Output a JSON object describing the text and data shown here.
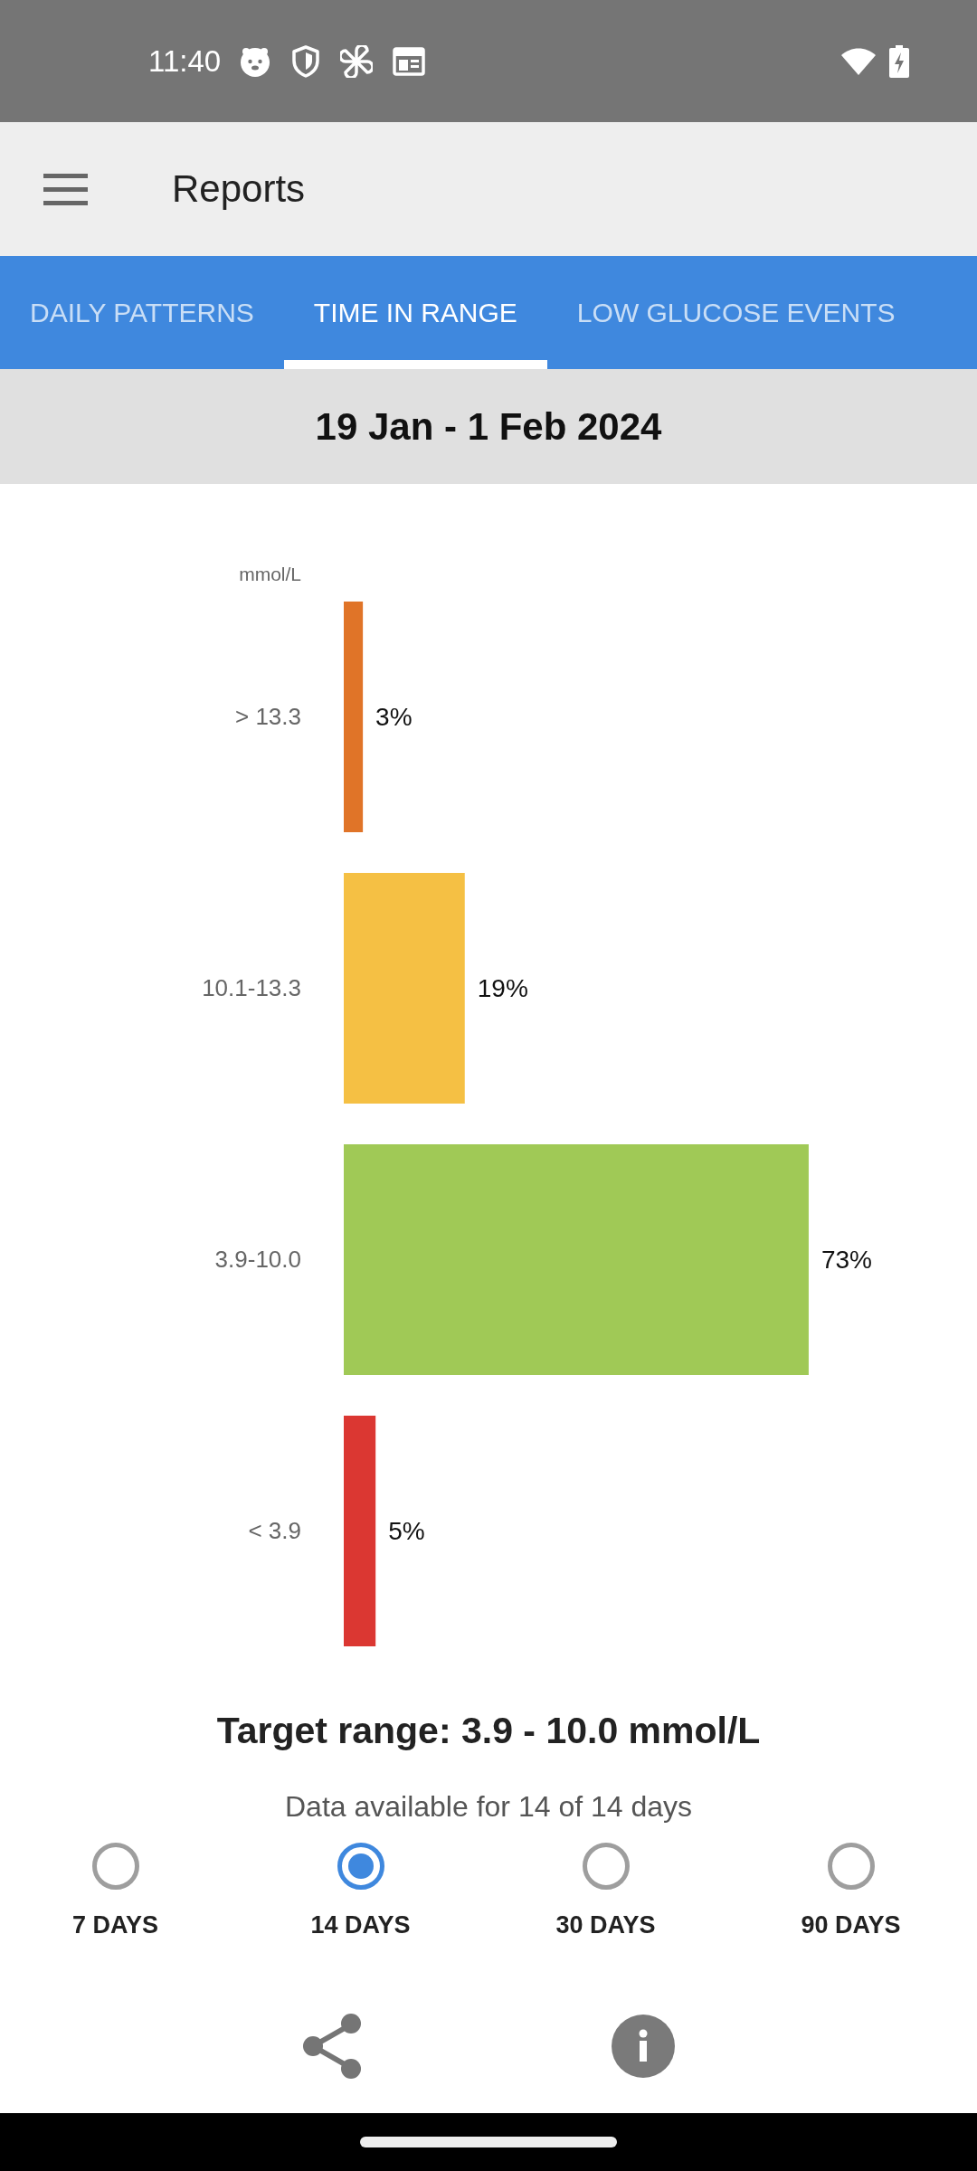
{
  "status_bar": {
    "time": "11:40"
  },
  "app_bar": {
    "title": "Reports"
  },
  "tabs": [
    {
      "label": "DAILY PATTERNS",
      "selected": false
    },
    {
      "label": "TIME IN RANGE",
      "selected": true
    },
    {
      "label": "LOW GLUCOSE EVENTS",
      "selected": false
    }
  ],
  "date_range": "19 Jan - 1 Feb 2024",
  "chart": {
    "chart_data": {
      "type": "bar",
      "orientation": "horizontal",
      "ylabel": "mmol/L",
      "categories": [
        "> 13.3",
        "10.1-13.3",
        "3.9-10.0",
        "< 3.9"
      ],
      "values": [
        3,
        19,
        73,
        5
      ],
      "value_labels": [
        "3%",
        "19%",
        "73%",
        "5%"
      ],
      "colors": [
        "#e07428",
        "#f5c044",
        "#a0c956",
        "#db3732"
      ]
    }
  },
  "target_range": "Target range: 3.9 - 10.0 mmol/L",
  "data_availability": "Data available for 14 of 14 days",
  "periods": [
    {
      "label": "7 DAYS",
      "selected": false
    },
    {
      "label": "14 DAYS",
      "selected": true
    },
    {
      "label": "30 DAYS",
      "selected": false
    },
    {
      "label": "90 DAYS",
      "selected": false
    }
  ]
}
